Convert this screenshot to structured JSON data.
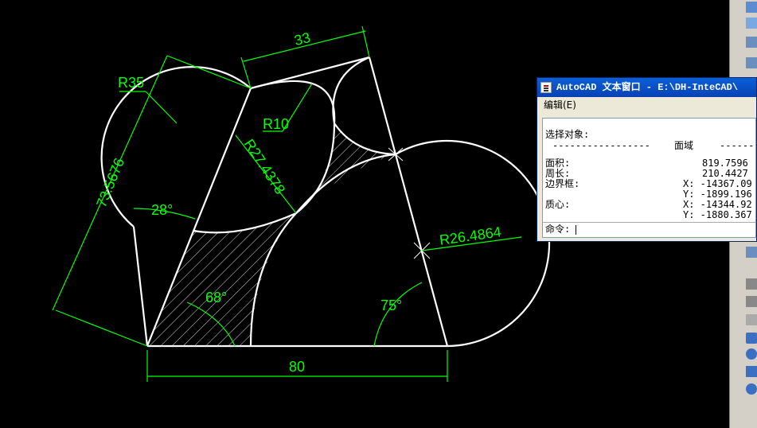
{
  "drawing": {
    "dims": {
      "top_width": "33",
      "radius_left": "R35",
      "radius_small": "R10",
      "radius_mid": "R27.4378",
      "radius_right": "R26.4864",
      "slant_length": "73.5676",
      "angle_left": "28°",
      "angle_bottom_left": "68°",
      "angle_bottom_right": "75°",
      "base_width": "80"
    },
    "colors": {
      "background": "#000000",
      "geometry": "#ffffff",
      "dimension": "#00ff00"
    }
  },
  "text_window": {
    "title": "AutoCAD 文本窗口 - E:\\DH-InteCAD\\",
    "menu_edit": "编辑(E)",
    "line_select": "选择对象:",
    "line_sep_left": "-----------------",
    "line_region": "面域",
    "line_sep_right": "-------",
    "area_label": "面积:",
    "area_value": "819.7596",
    "perimeter_label": "周长:",
    "perimeter_value": "210.4427",
    "bbox_label": "边界框:",
    "bbox_x": "X: -14367.09",
    "bbox_y": "Y: -1899.196",
    "centroid_label": "质心:",
    "centroid_x": "X: -14344.92",
    "centroid_y": "Y: -1880.367",
    "command_label": "命令:"
  }
}
